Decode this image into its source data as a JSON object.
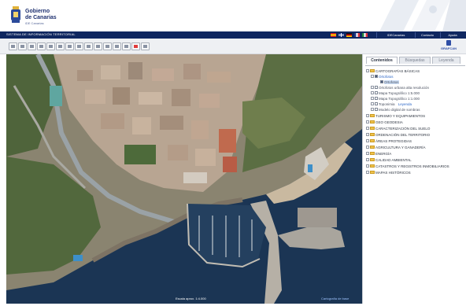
{
  "header": {
    "logo_title_line1": "Gobierno",
    "logo_title_line2": "de Canarias",
    "logo_subtitle": "iDE Canarias"
  },
  "sysbar": {
    "title": "SISTEMA DE INFORMACIÓN TERRITORIAL",
    "links": [
      "IDECanarias",
      "Contacto",
      "Ayuda"
    ]
  },
  "toolbar": {
    "brand": "GRAFCAN"
  },
  "map": {
    "scale_label": "Escala aprox. 1:4.000",
    "credit_label": "Cartografía de base"
  },
  "panel": {
    "tabs": [
      "Contenidos",
      "Búsquedas",
      "Leyenda"
    ],
    "tree": [
      "CARTOGRAFÍAS BÁSICAS",
      "Ortofotos",
      "Ortofotos",
      "Ortofotos urbana alta resolución",
      "Mapa Topográfico 1:5.000",
      "Mapa Topográfico 1:1.000",
      "Toponimia",
      "Modelo digital de sombras",
      "TURISMO Y EQUIPAMIENTOS",
      "GEO GEODESIA",
      "CARACTERIZACIÓN DEL SUELO",
      "ORDENACIÓN DEL TERRITORIO",
      "ÁREAS PROTEGIDAS",
      "AGRICULTURA Y GANADERÍA",
      "ENERGÍA",
      "CALIDAD AMBIENTAL",
      "CATASTROS Y REGISTROS INMOBILIARIOS",
      "MAPAS HISTÓRICOS"
    ],
    "info_link": "Leyenda"
  },
  "colors": {
    "brand_blue": "#0f2760",
    "accent_blue": "#2f4ea5",
    "sea": "#1b3554",
    "folder": "#f0c24b"
  }
}
